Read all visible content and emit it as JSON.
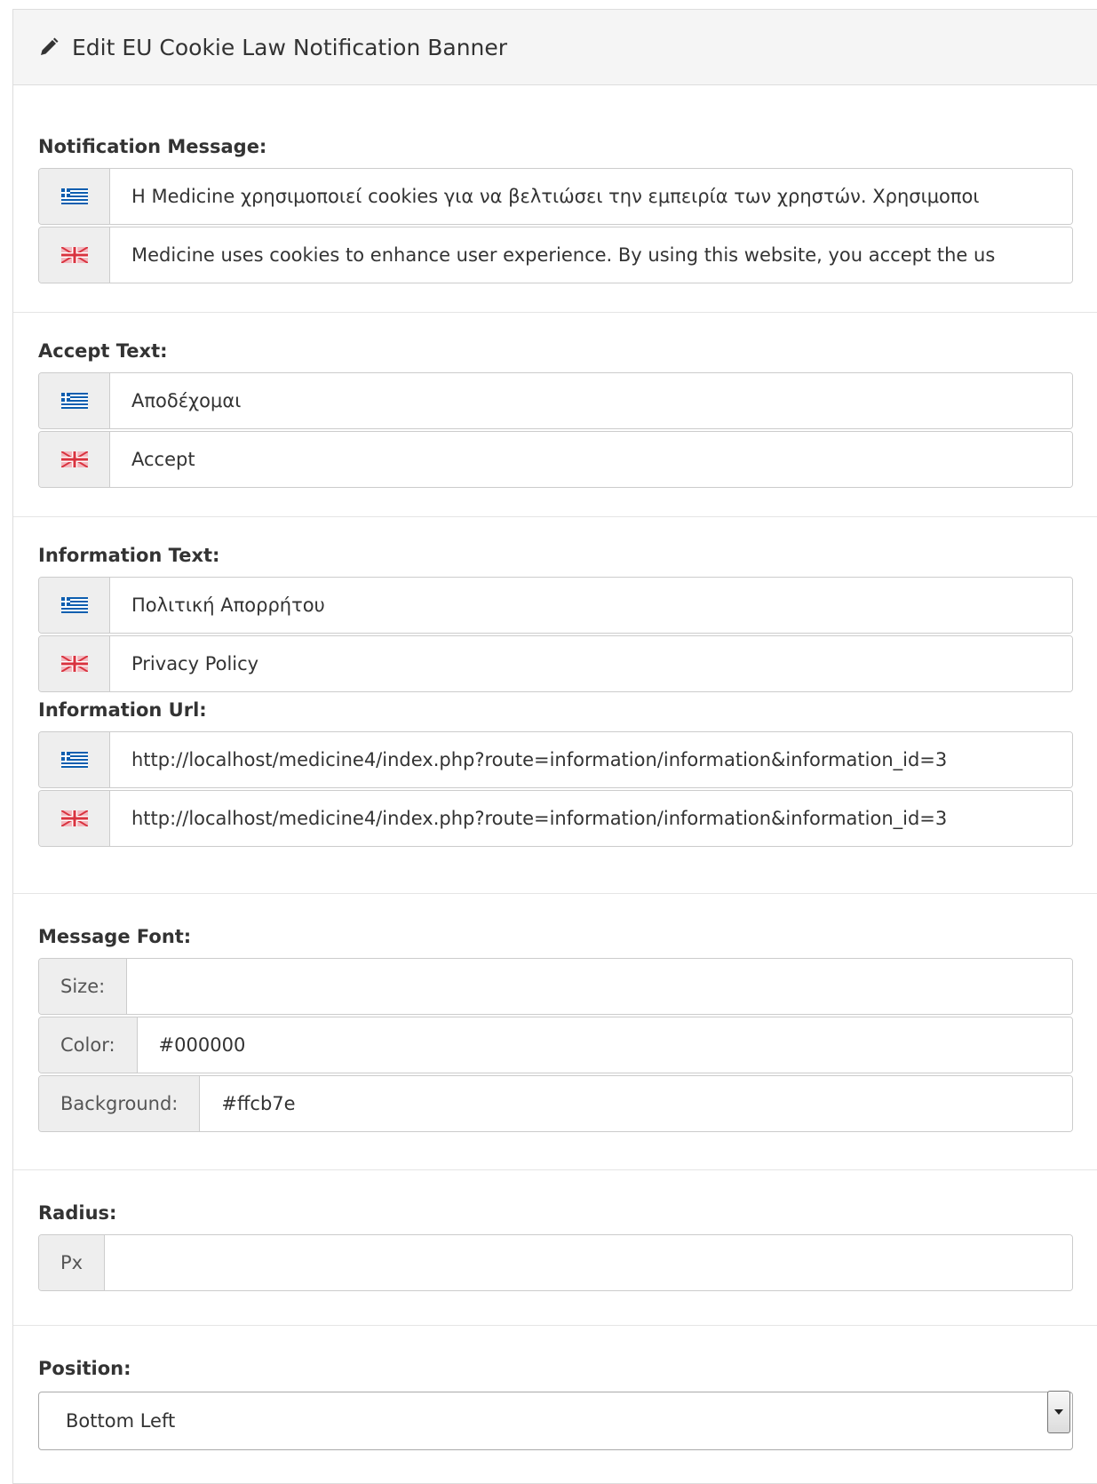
{
  "header": {
    "title": "Edit EU Cookie Law Notification Banner"
  },
  "notification_message": {
    "label": "Notification Message:",
    "greek_value": "Η Medicine χρησιμοποιεί cookies για να βελτιώσει την εμπειρία των χρηστών. Χρησιμοποι",
    "english_value": " Medicine uses cookies to enhance user experience. By using this website, you accept the us"
  },
  "accept_text": {
    "label": "Accept Text:",
    "greek_value": "Αποδέχομαι",
    "english_value": "Accept"
  },
  "information_text": {
    "label": "Information Text:",
    "greek_value": "Πολιτική Απορρήτου",
    "english_value": "Privacy Policy"
  },
  "information_url": {
    "label": "Information Url:",
    "greek_value": "http://localhost/medicine4/index.php?route=information/information&information_id=3",
    "english_value": "http://localhost/medicine4/index.php?route=information/information&information_id=3"
  },
  "message_font": {
    "label": "Message Font:",
    "size_label": "Size:",
    "size_value": "",
    "color_label": "Color:",
    "color_value": "#000000",
    "background_label": "Background:",
    "background_value": "#ffcb7e"
  },
  "radius": {
    "label": "Radius:",
    "unit_label": "Px",
    "value": ""
  },
  "position": {
    "label": "Position:",
    "selected": "Bottom Left"
  },
  "icons": {
    "greek_flag": "greek-flag-icon",
    "uk_flag": "uk-flag-icon",
    "pencil": "pencil-icon"
  },
  "colors": {
    "heading_bg": "#f5f5f5",
    "addon_bg": "#eeeeee",
    "border": "#cccccc"
  }
}
